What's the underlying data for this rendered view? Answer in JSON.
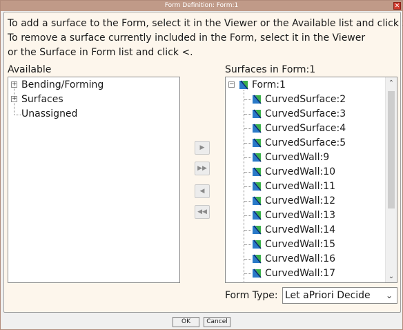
{
  "window": {
    "title": "Form Definition: Form:1",
    "close_glyph": "✕"
  },
  "instructions": [
    "To add a surface to the Form, select it in the Viewer or the Available list and click >.",
    "To remove a surface currently included in the Form, select it in the Viewer",
    "or the Surface in Form list and click <."
  ],
  "available": {
    "label": "Available",
    "items": [
      {
        "label": "Bending/Forming",
        "expander": "+"
      },
      {
        "label": "Surfaces",
        "expander": "+"
      },
      {
        "label": "Unassigned"
      }
    ]
  },
  "transfer_buttons": [
    {
      "name": "add-button",
      "glyph": "▶"
    },
    {
      "name": "add-all-button",
      "glyph": "▶▶"
    },
    {
      "name": "remove-button",
      "glyph": "◀"
    },
    {
      "name": "remove-all-button",
      "glyph": "◀◀"
    }
  ],
  "form_surfaces": {
    "label": "Surfaces in Form:1",
    "root": {
      "label": "Form:1",
      "expander": "−"
    },
    "items": [
      "CurvedSurface:2",
      "CurvedSurface:3",
      "CurvedSurface:4",
      "CurvedSurface:5",
      "CurvedWall:9",
      "CurvedWall:10",
      "CurvedWall:11",
      "CurvedWall:12",
      "CurvedWall:13",
      "CurvedWall:14",
      "CurvedWall:15",
      "CurvedWall:16",
      "CurvedWall:17"
    ]
  },
  "form_type": {
    "label": "Form Type:",
    "value": "Let aPriori Decide",
    "caret": "⌄"
  },
  "footer": {
    "ok_label": "OK",
    "cancel_label": "Cancel"
  },
  "scroll_arrows": {
    "up": "⌃",
    "down": "⌄"
  },
  "colors": {
    "title_bar": "#c09a88",
    "panel": "#fdf6ec",
    "close": "#d03a2c"
  }
}
